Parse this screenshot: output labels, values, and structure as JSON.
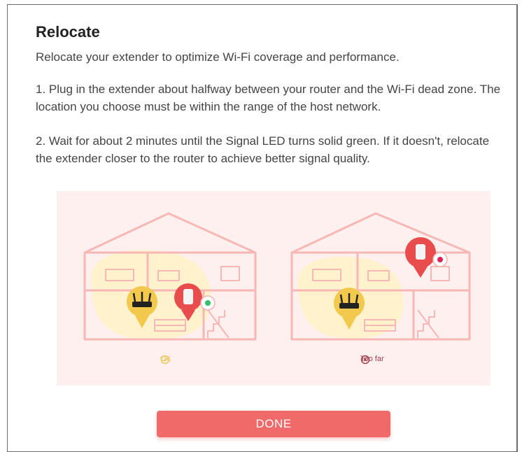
{
  "dialog": {
    "title": "Relocate",
    "intro": "Relocate your extender to optimize Wi-Fi coverage and performance.",
    "step1": "1. Plug in the extender about halfway between your router and the Wi-Fi dead zone. The location you choose must be within the range of the host network.",
    "step2": "2. Wait for about 2 minutes until the Signal LED turns solid green. If it doesn't, relocate the extender closer to the router to achieve better signal quality."
  },
  "illustration": {
    "ok_label": "OK",
    "too_far_label": "Too far",
    "icons": [
      "check-circle-icon",
      "x-circle-icon",
      "router-icon",
      "extender-icon"
    ],
    "colors": {
      "background": "#fdf0ef",
      "house_lines": "#f7b8b5",
      "coverage": "#fff3c4",
      "router_pin": "#f2c94c",
      "extender_pin": "#e84c4c",
      "ok": "#e7c75c",
      "too_far": "#a23b4a"
    }
  },
  "actions": {
    "done_label": "DONE",
    "done_color": "#f06a6a"
  }
}
